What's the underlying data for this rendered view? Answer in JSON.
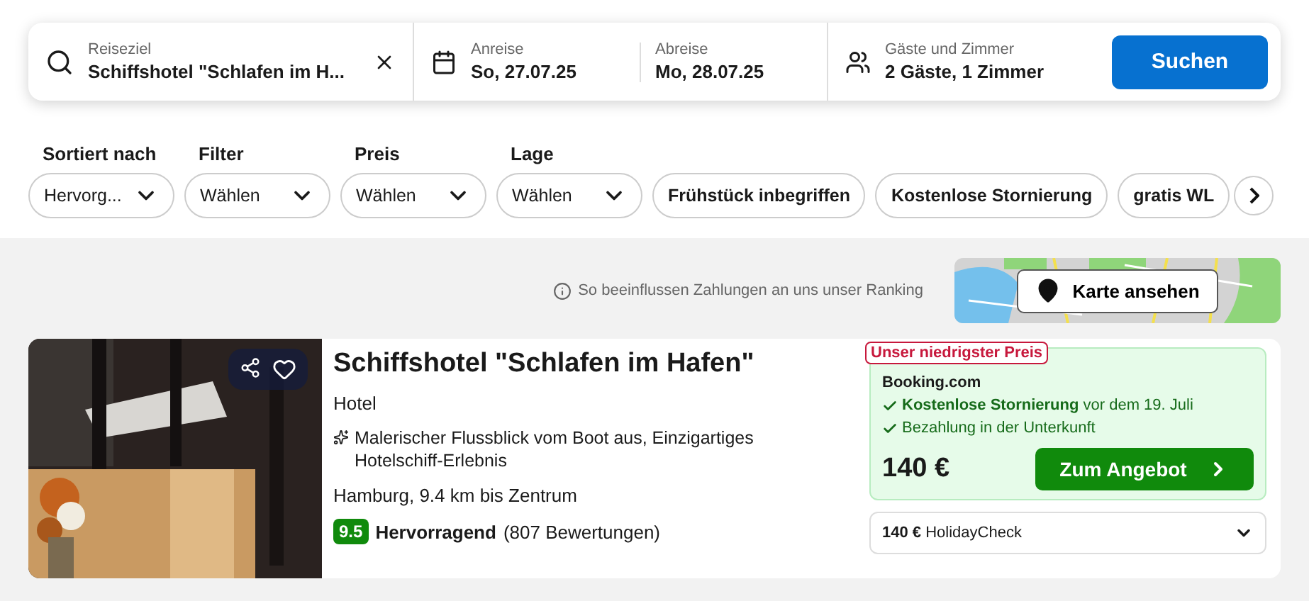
{
  "search": {
    "destination": {
      "label": "Reiseziel",
      "value": "Schiffshotel \"Schlafen im H..."
    },
    "checkin": {
      "label": "Anreise",
      "value": "So, 27.07.25"
    },
    "checkout": {
      "label": "Abreise",
      "value": "Mo, 28.07.25"
    },
    "guests": {
      "label": "Gäste und Zimmer",
      "value": "2 Gäste, 1 Zimmer"
    },
    "button": "Suchen"
  },
  "dropdowns": [
    {
      "label": "Sortiert nach",
      "value": "Hervorg..."
    },
    {
      "label": "Filter",
      "value": "Wählen"
    },
    {
      "label": "Preis",
      "value": "Wählen"
    },
    {
      "label": "Lage",
      "value": "Wählen"
    }
  ],
  "quick_filters": [
    {
      "label": "Frühstück inbegriffen",
      "selected": false
    },
    {
      "label": "Kostenlose Stornierung",
      "selected": false
    },
    {
      "label": "gratis WL",
      "selected": false
    }
  ],
  "ranking_info": "So beeinflussen Zahlungen an uns unser Ranking",
  "map_button": "Karte ansehen",
  "results": [
    {
      "name": "Schiffshotel \"Schlafen im Hafen\"",
      "type": "Hotel",
      "highlight": "Malerischer Flussblick vom Boot aus, Einzigartiges Hotelschiff-Erlebnis",
      "location": "Hamburg, 9.4 km bis Zentrum",
      "score": "9.5",
      "rating_label": "Hervorragend",
      "reviews": "(807 Bewertungen)",
      "favorite": false,
      "deal": {
        "badge": "Unser niedrigster Preis",
        "provider": "Booking.com",
        "perks": [
          "**Kostenlose Stornierung** vor dem 19. Juli",
          "Bezahlung in der Unterkunft"
        ],
        "price": "140 €",
        "button": "Zum Angebot"
      },
      "other_offer": {
        "price": "140 €",
        "provider": "HolidayCheck"
      }
    }
  ]
}
